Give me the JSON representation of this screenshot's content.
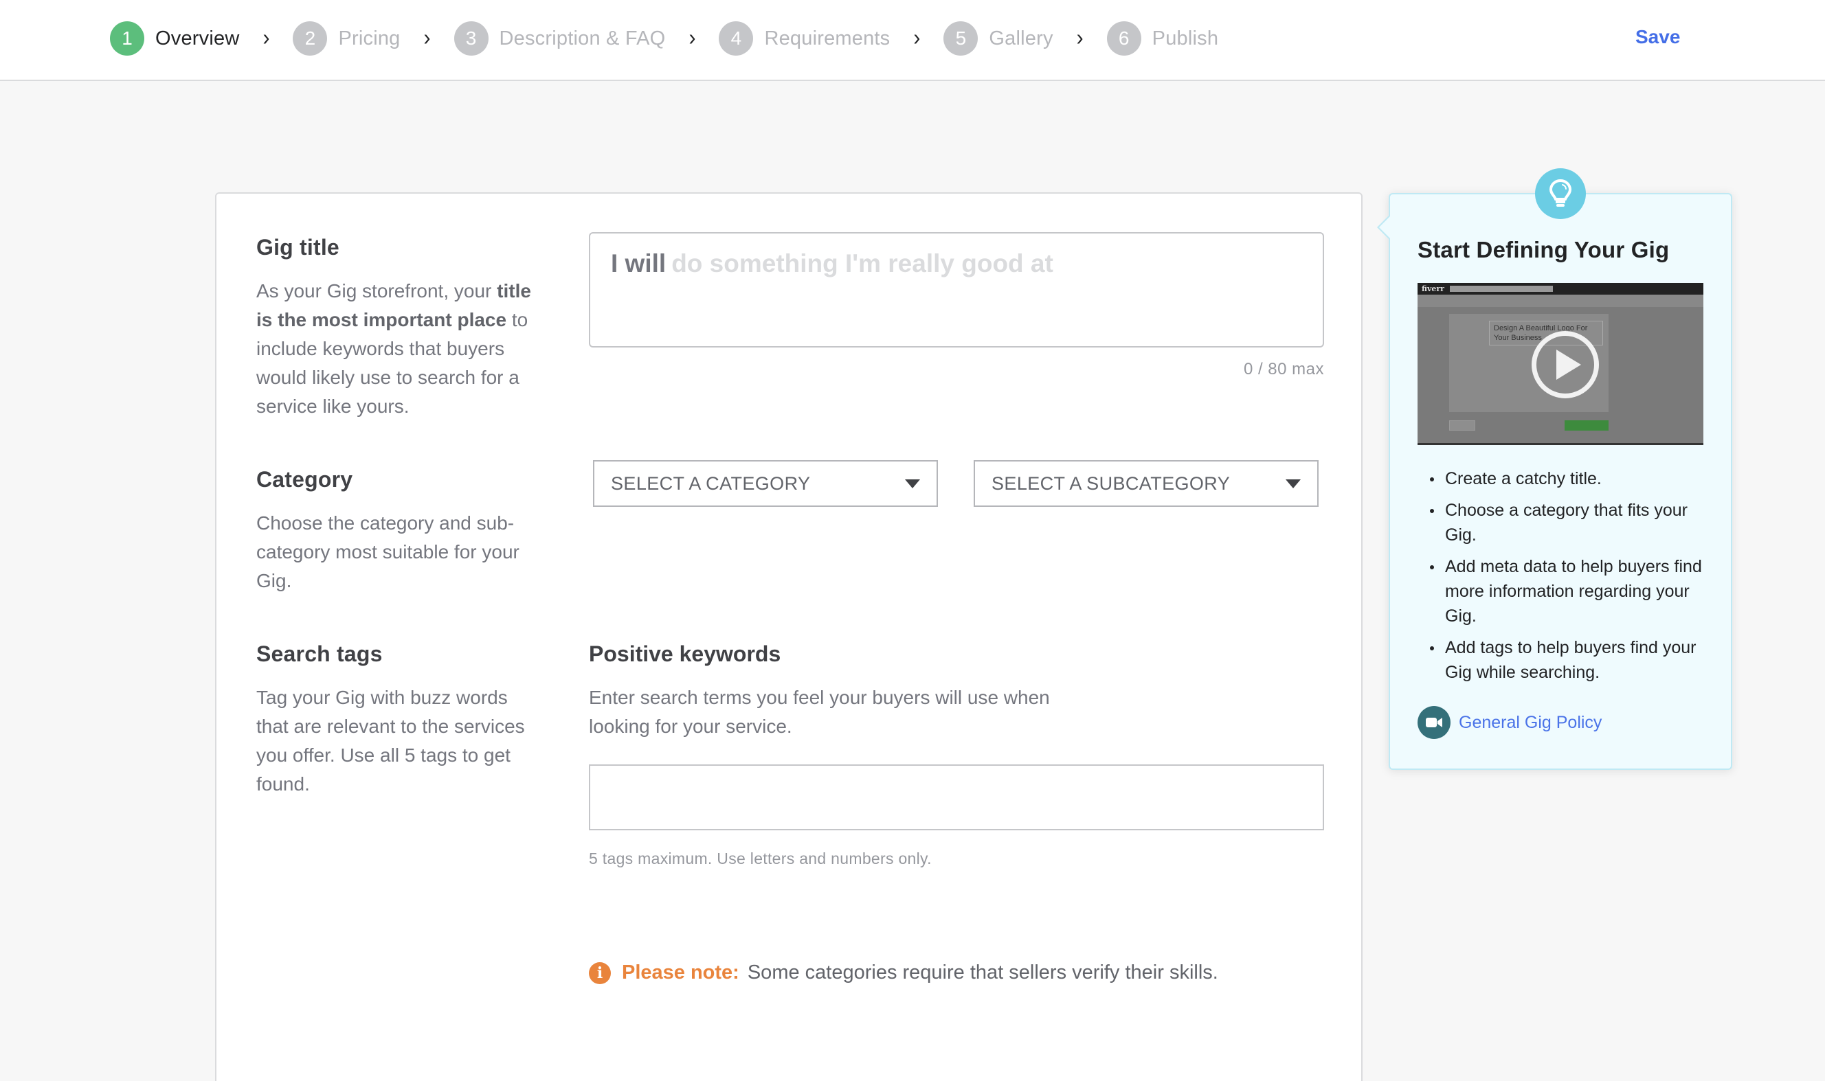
{
  "header": {
    "steps": [
      {
        "number": "1",
        "label": "Overview",
        "active": true
      },
      {
        "number": "2",
        "label": "Pricing",
        "active": false
      },
      {
        "number": "3",
        "label": "Description & FAQ",
        "active": false
      },
      {
        "number": "4",
        "label": "Requirements",
        "active": false
      },
      {
        "number": "5",
        "label": "Gallery",
        "active": false
      },
      {
        "number": "6",
        "label": "Publish",
        "active": false
      }
    ],
    "separator_icon": "chevron-right-icon",
    "save_label": "Save"
  },
  "gig_title": {
    "heading": "Gig title",
    "desc_before": "As your Gig storefront, your ",
    "desc_bold": "title is the most important place",
    "desc_after": " to include keywords that buyers would likely use to search for a service like yours.",
    "input_prefix": "I will",
    "input_placeholder": "do something I'm really good at",
    "input_value": "",
    "counter": "0 / 80 max"
  },
  "category": {
    "heading": "Category",
    "description": "Choose the category and sub-category most suitable for your Gig.",
    "category_select": "SELECT A CATEGORY",
    "subcategory_select": "SELECT A SUBCATEGORY"
  },
  "search_tags": {
    "heading": "Search tags",
    "description": "Tag your Gig with buzz words that are relevant to the services you offer. Use all 5 tags to get found.",
    "positive_keywords_title": "Positive keywords",
    "positive_keywords_desc": "Enter search terms you feel your buyers will use when looking for your service.",
    "input_value": "",
    "hint": "5 tags maximum. Use letters and numbers only."
  },
  "note": {
    "icon": "info-icon",
    "strong": "Please note:",
    "text": "Some categories require that sellers verify their skills."
  },
  "tip_panel": {
    "icon": "lightbulb-icon",
    "title": "Start Defining Your Gig",
    "video": {
      "logo": "fiverr",
      "sample_title": "Design A Beautiful Logo For Your Business",
      "cancel": "Cancel",
      "continue": "Save & Continue"
    },
    "tips": [
      "Create a catchy title.",
      "Choose a category that fits your Gig.",
      "Add meta data to help buyers find more information regarding your Gig.",
      "Add tags to help buyers find your Gig while searching."
    ],
    "policy_link": "General Gig Policy"
  },
  "colors": {
    "active_step": "#5cbe7c",
    "inactive_step": "#c5c6c9",
    "link": "#446ee7",
    "note_accent": "#e9843c",
    "tip_bg": "#effbfe",
    "bulb": "#6bcde4",
    "camera": "#34707a"
  }
}
